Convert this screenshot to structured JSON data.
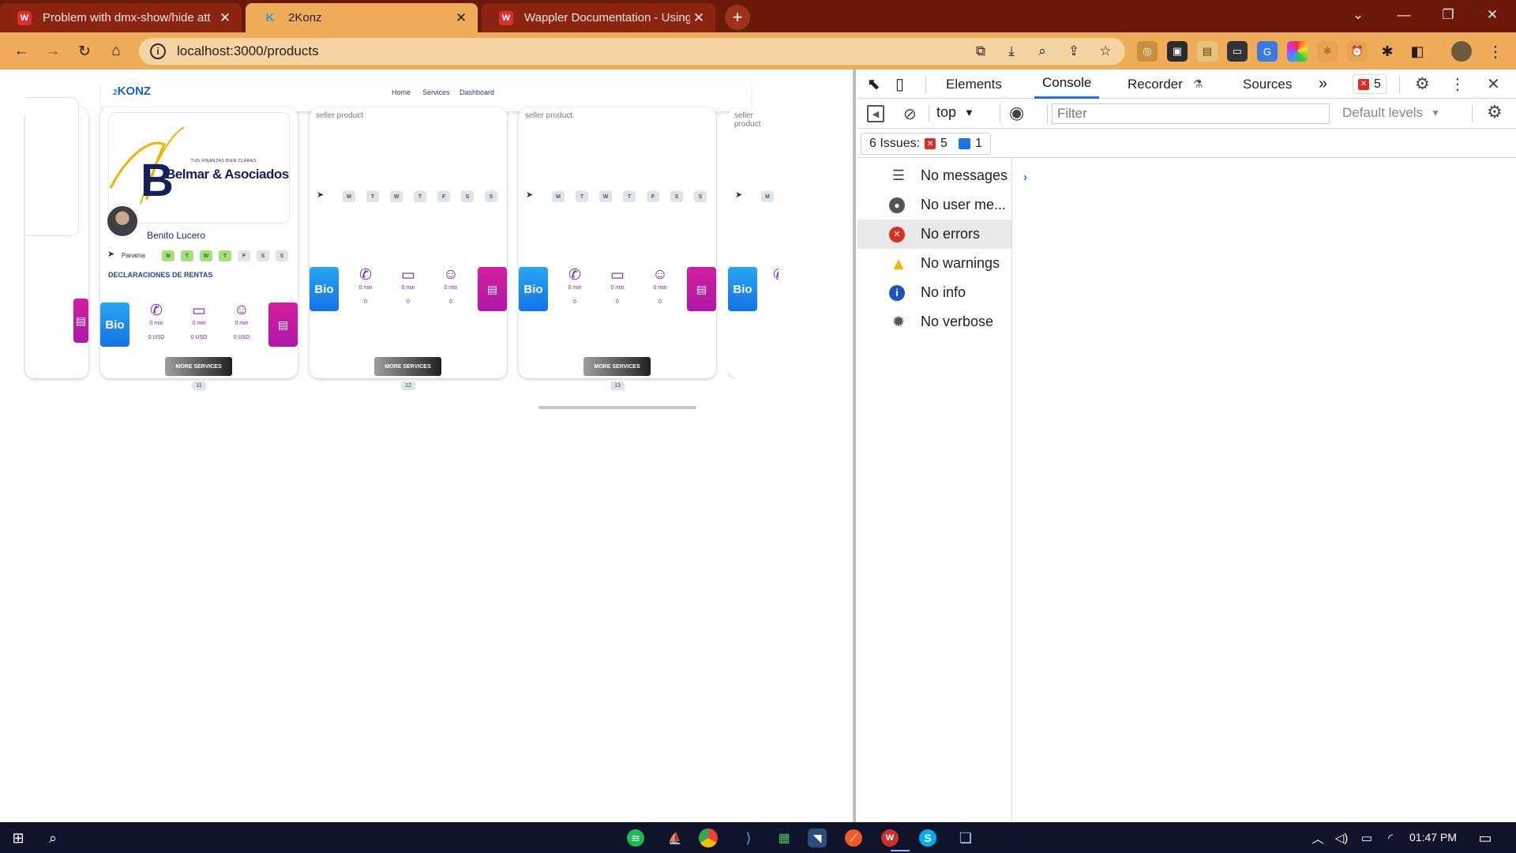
{
  "browser": {
    "tabs": [
      {
        "title": "Problem with dmx-show/hide att",
        "favicon": "wappler-logo",
        "state": "inactive"
      },
      {
        "title": "2Konz",
        "favicon": "konz-logo",
        "state": "active"
      },
      {
        "title": "Wappler Documentation - Using",
        "favicon": "wappler-logo",
        "state": "inactive"
      }
    ],
    "url": "localhost:3000/products",
    "colors": {
      "tabstrip": "#6b1a0a",
      "toolbar": "#efad5b",
      "omnibox": "#f7d4a3"
    }
  },
  "page": {
    "logo": {
      "prefix": "2",
      "name": "KONZ"
    },
    "nav": [
      "Home",
      "Services",
      "Dashboard"
    ],
    "cards": [
      {
        "number": "11",
        "logo_tagline": "TUS FINANZAS BIEN CLARAS",
        "logo_text": "Belmar & Asociados",
        "name": "Benito Lucero",
        "location": "Panama",
        "days": [
          "M",
          "T",
          "W",
          "T",
          "F",
          "S",
          "S"
        ],
        "active_days": [
          true,
          true,
          true,
          true,
          false,
          false,
          false
        ],
        "category": "DECLARACIONES DE RENTAS",
        "bio_label": "Bio",
        "services": [
          {
            "icon": "phone-icon",
            "minutes": "0 min",
            "price": "0 USD"
          },
          {
            "icon": "video-icon",
            "minutes": "0 min",
            "price": "0 USD"
          },
          {
            "icon": "person-icon",
            "minutes": "0 min",
            "price": "0 USD"
          }
        ],
        "more_label": "MORE SERVICES"
      },
      {
        "number": "12",
        "broken_image_alt": "seller product",
        "days": [
          "M",
          "T",
          "W",
          "T",
          "F",
          "S",
          "S"
        ],
        "bio_label": "Bio",
        "services": [
          {
            "icon": "phone-icon",
            "minutes": "0 min",
            "price": "0"
          },
          {
            "icon": "video-icon",
            "minutes": "0 min",
            "price": "0"
          },
          {
            "icon": "person-icon",
            "minutes": "0 min",
            "price": "0"
          }
        ],
        "more_label": "MORE SERVICES"
      },
      {
        "number": "13",
        "broken_image_alt": "seller product",
        "days": [
          "M",
          "T",
          "W",
          "T",
          "F",
          "S",
          "S"
        ],
        "bio_label": "Bio",
        "services": [
          {
            "icon": "phone-icon",
            "minutes": "0 min",
            "price": "0"
          },
          {
            "icon": "video-icon",
            "minutes": "0 min",
            "price": "0"
          },
          {
            "icon": "person-icon",
            "minutes": "0 min",
            "price": "0"
          }
        ],
        "more_label": "MORE SERVICES"
      },
      {
        "broken_image_alt": "seller product",
        "days": [
          "M"
        ],
        "bio_label": "Bio"
      }
    ]
  },
  "devtools": {
    "tabs": [
      "Elements",
      "Console",
      "Recorder",
      "Sources"
    ],
    "selected_tab": "Console",
    "error_badge": "5",
    "context": "top",
    "filter_placeholder": "Filter",
    "levels": "Default levels",
    "issues": {
      "label": "6 Issues:",
      "errors": "5",
      "info": "1"
    },
    "sidebar": [
      {
        "label": "No messages",
        "icon": "list-icon"
      },
      {
        "label": "No user me...",
        "icon": "user-icon"
      },
      {
        "label": "No errors",
        "icon": "error-icon",
        "selected": true
      },
      {
        "label": "No warnings",
        "icon": "warning-icon"
      },
      {
        "label": "No info",
        "icon": "info-icon"
      },
      {
        "label": "No verbose",
        "icon": "bug-icon"
      }
    ]
  },
  "taskbar": {
    "time": "01:47 PM"
  }
}
